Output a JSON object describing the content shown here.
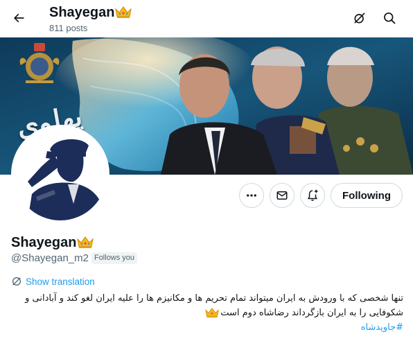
{
  "header": {
    "title": "Shayegan",
    "post_count": "811 posts"
  },
  "icons": {
    "back": "arrow-left-icon",
    "grok": "grok-slash-icon",
    "search": "search-icon",
    "more": "more-horizontal-icon",
    "message": "envelope-icon",
    "notify": "bell-plus-icon",
    "translate": "translate-icon",
    "crown": "crown-emoji"
  },
  "banner": {
    "calligraphy": "پهلوی"
  },
  "actions": {
    "following_label": "Following"
  },
  "profile": {
    "name": "Shayegan",
    "handle": "@Shayegan_m2",
    "follows_you": "Follows you",
    "show_translation": "Show translation",
    "bio_text": "تنها شخصی که با ورودش به ایران میتواند تمام تحریم ها و مکانیزم ها را علیه ایران لغو کند و آبادانی و شکوفایی را به ایران بازگرداند رضاشاه دوم است",
    "hashtag": "#جاویدشاه"
  },
  "colors": {
    "accent": "#1d9bf0",
    "text_primary": "#0f1419",
    "text_secondary": "#536471",
    "border": "#cfd9de",
    "crown_gold": "#f5b81c"
  }
}
